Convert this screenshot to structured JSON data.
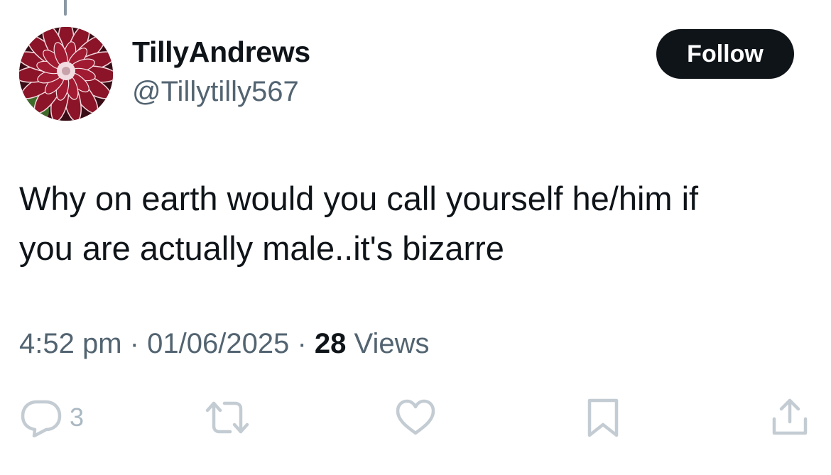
{
  "author": {
    "display_name": "TillyAndrews",
    "handle": "@Tillytilly567"
  },
  "follow_button": {
    "label": "Follow"
  },
  "tweet": {
    "text_line_1": "Why on earth would you call yourself he/him if",
    "text_line_2": "you are actually male..it's bizarre"
  },
  "meta": {
    "time": "4:52 pm",
    "separator": "·",
    "date": "01/06/2025",
    "views_count": "28",
    "views_label": "Views"
  },
  "actions": {
    "reply_count": "3",
    "icons": [
      "reply-icon",
      "retweet-icon",
      "like-icon",
      "bookmark-icon",
      "share-icon"
    ],
    "icon_color": "#c4ccd3"
  },
  "colors": {
    "text_primary": "#0f1419",
    "text_secondary": "#536471",
    "follow_bg": "#0f1419",
    "follow_text": "#ffffff",
    "avatar_flower": "#8b1428"
  }
}
